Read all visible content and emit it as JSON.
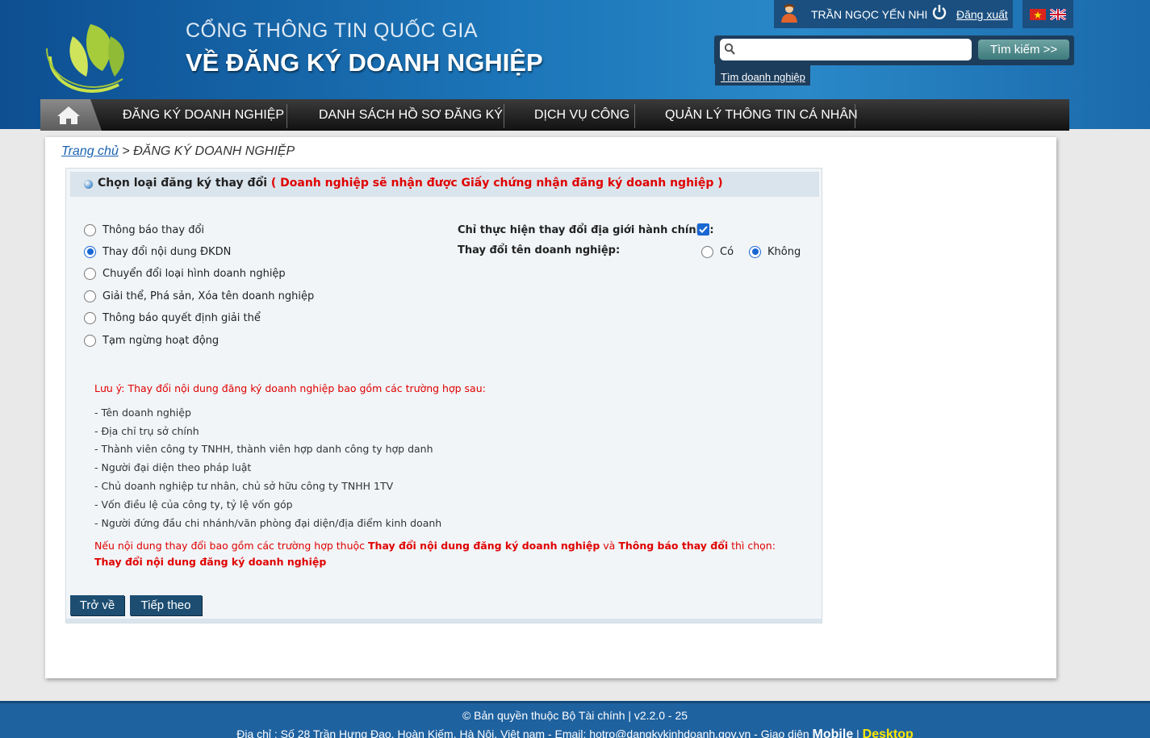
{
  "header": {
    "title_line1": "CỔNG THÔNG TIN QUỐC GIA",
    "title_line2": "VỀ ĐĂNG KÝ DOANH NGHIỆP",
    "user_name": "TRẦN NGỌC YẾN NHI",
    "logout_label": "Đăng xuất",
    "search_placeholder": "",
    "search_button": "Tìm kiếm >>",
    "find_business_link": "Tìm doanh nghiệp"
  },
  "nav": {
    "items": [
      "ĐĂNG KÝ DOANH NGHIỆP",
      "DANH SÁCH HỒ SƠ ĐĂNG KÝ",
      "DỊCH VỤ CÔNG",
      "QUẢN LÝ THÔNG TIN CÁ NHÂN"
    ]
  },
  "breadcrumb": {
    "home": "Trang chủ",
    "separator": " > ",
    "current": "ĐĂNG KÝ DOANH NGHIỆP"
  },
  "panel": {
    "title": "Chọn loại đăng ký thay đổi",
    "title_note": "( Doanh nghiệp sẽ nhận được Giấy chứng nhận đăng ký doanh nghiệp )",
    "options": [
      {
        "label": "Thông báo thay đổi",
        "selected": false
      },
      {
        "label": "Thay đổi nội dung ĐKDN",
        "selected": true
      },
      {
        "label": "Chuyển đổi loại hình doanh nghiệp",
        "selected": false
      },
      {
        "label": "Giải thể, Phá sản, Xóa tên doanh nghiệp",
        "selected": false
      },
      {
        "label": "Thông báo quyết định giải thể",
        "selected": false
      },
      {
        "label": "Tạm ngừng hoạt động",
        "selected": false
      }
    ],
    "admin_boundary_label": "Chỉ thực hiện thay đổi địa giới hành chính?:",
    "admin_boundary_checked": true,
    "rename_label": "Thay đổi tên doanh nghiệp:",
    "rename_yes": "Có",
    "rename_no": "Không",
    "rename_value": "Không",
    "note_lead": "Lưu ý: Thay đổi nội dung đăng ký doanh nghiệp bao gồm các trường hợp sau:",
    "note_items": [
      "- Tên doanh nghiệp",
      "- Địa chỉ trụ sở chính",
      "- Thành viên công ty TNHH, thành viên hợp danh công ty hợp danh",
      "- Người đại diện theo pháp luật",
      "- Chủ doanh nghiệp tư nhân, chủ sở hữu công ty TNHH 1TV",
      "- Vốn điều lệ của công ty, tỷ lệ vốn góp",
      "- Người đứng đầu chi nhánh/văn phòng đại diện/địa điểm kinh doanh"
    ],
    "final_part1": "Nếu nội dung thay đổi bao gồm các trường hợp thuộc ",
    "final_bold1": "Thay đổi nội dung đăng ký doanh nghiệp",
    "final_part2": " và ",
    "final_bold2": "Thông báo thay đổi",
    "final_part3": " thì chọn: ",
    "final_bold3": "Thay đổi nội dung đăng ký doanh nghiệp",
    "back_button": "Trở về",
    "next_button": "Tiếp theo"
  },
  "footer": {
    "copyright": "© Bản quyền thuộc Bộ Tài chính | v2.2.0 - 25",
    "address": "Địa chỉ : Số 28 Trần Hưng Đạo, Hoàn Kiếm, Hà Nội, Việt nam - Email: ",
    "email": "hotro@dangkykinhdoanh.gov.vn",
    "ui_label": " - Giao diện ",
    "mobile": "Mobile",
    "sep": " | ",
    "desktop": "Desktop"
  },
  "colors": {
    "header_blue": "#1c76b9",
    "nav_dark": "#1a1a1a",
    "accent_red": "#e00000",
    "button_navy": "#1d4e72",
    "footer_blue": "#1f62a0"
  }
}
